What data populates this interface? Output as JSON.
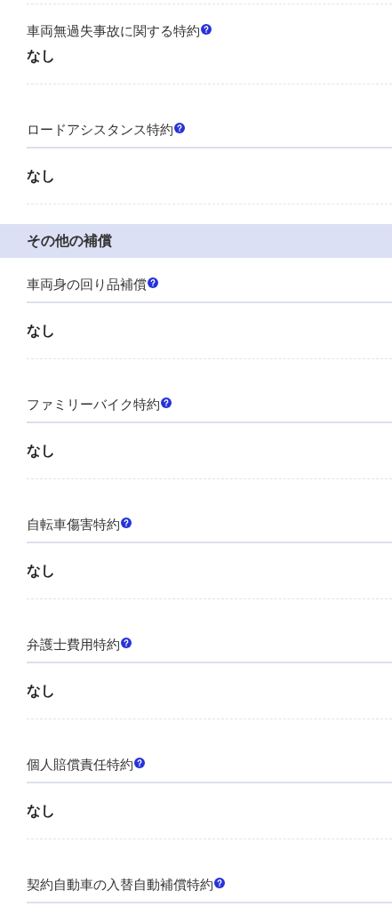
{
  "sections": [
    {
      "items": [
        {
          "label": "車両無過失事故に関する特約",
          "underlined": false,
          "value": "なし"
        },
        {
          "label": "ロードアシスタンス特約",
          "underlined": true,
          "value": "なし"
        }
      ]
    },
    {
      "title": "その他の補償",
      "items": [
        {
          "label": "車両身の回り品補償",
          "underlined": true,
          "value": "なし"
        },
        {
          "label": "ファミリーバイク特約",
          "underlined": true,
          "value": "なし"
        },
        {
          "label": "自転車傷害特約",
          "underlined": true,
          "value": "なし"
        },
        {
          "label": "弁護士費用特約",
          "underlined": true,
          "value": "なし"
        },
        {
          "label": "個人賠償責任特約",
          "underlined": true,
          "value": "なし"
        },
        {
          "label": "契約自動車の入替自動補償特約",
          "underlined": true
        }
      ]
    }
  ]
}
